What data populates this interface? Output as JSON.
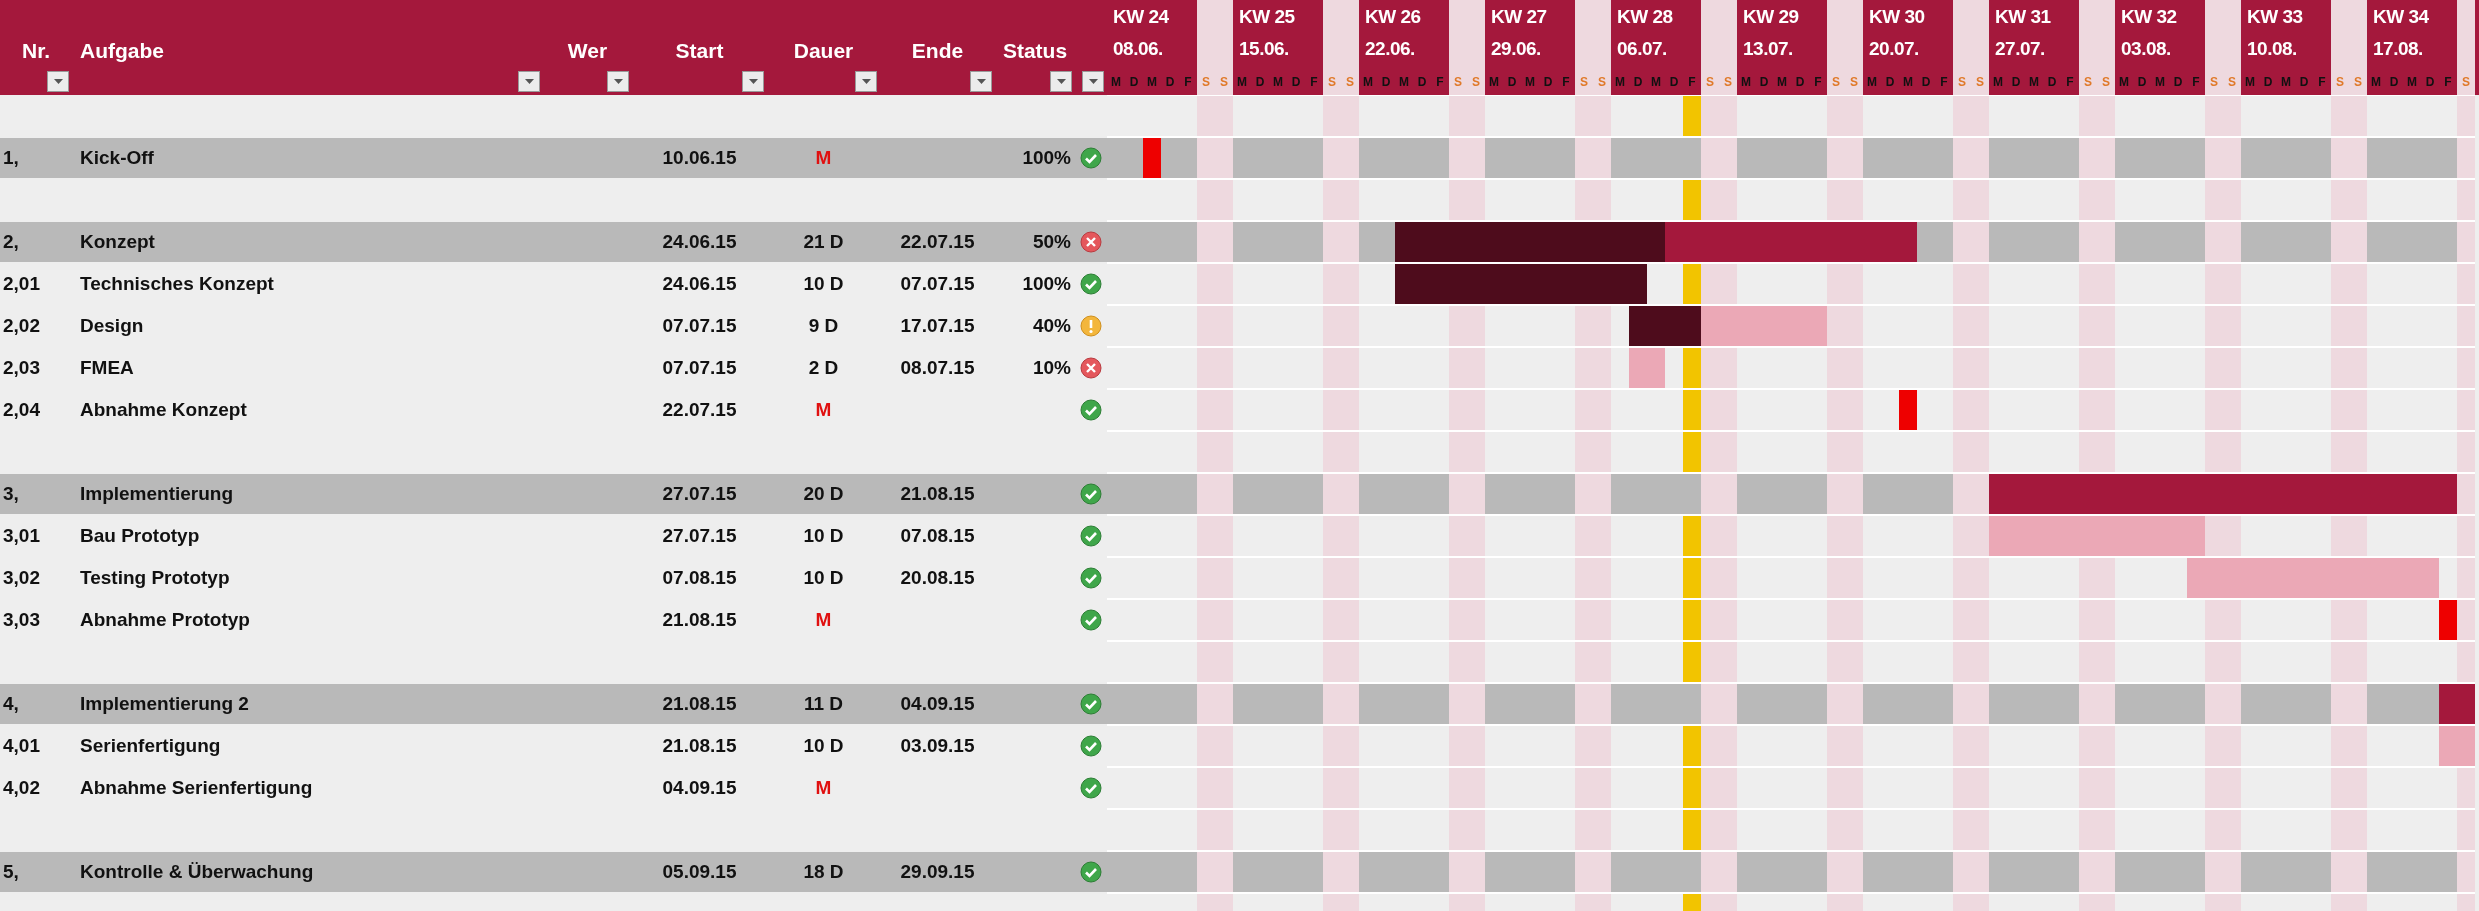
{
  "columns": [
    {
      "label": "Nr.",
      "filter": true
    },
    {
      "label": "Aufgabe",
      "filter": true
    },
    {
      "label": "Wer",
      "filter": true
    },
    {
      "label": "Start",
      "filter": true
    },
    {
      "label": "Dauer",
      "filter": true
    },
    {
      "label": "Ende",
      "filter": true
    },
    {
      "label": "Status",
      "filter": true
    },
    {
      "filter": true
    }
  ],
  "weeks": [
    {
      "kw": "KW 24",
      "date": "08.06.",
      "days": [
        {
          "label": "M",
          "weekend": false,
          "today": false
        },
        {
          "label": "D",
          "weekend": false,
          "today": false
        },
        {
          "label": "M",
          "weekend": false,
          "today": false
        },
        {
          "label": "D",
          "weekend": false,
          "today": false
        },
        {
          "label": "F",
          "weekend": false,
          "today": false
        },
        {
          "label": "S",
          "weekend": true,
          "today": false
        },
        {
          "label": "S",
          "weekend": true,
          "today": false
        }
      ]
    },
    {
      "kw": "KW 25",
      "date": "15.06.",
      "days": [
        {
          "label": "M",
          "weekend": false,
          "today": false
        },
        {
          "label": "D",
          "weekend": false,
          "today": false
        },
        {
          "label": "M",
          "weekend": false,
          "today": false
        },
        {
          "label": "D",
          "weekend": false,
          "today": false
        },
        {
          "label": "F",
          "weekend": false,
          "today": false
        },
        {
          "label": "S",
          "weekend": true,
          "today": false
        },
        {
          "label": "S",
          "weekend": true,
          "today": false
        }
      ]
    },
    {
      "kw": "KW 26",
      "date": "22.06.",
      "days": [
        {
          "label": "M",
          "weekend": false,
          "today": false
        },
        {
          "label": "D",
          "weekend": false,
          "today": false
        },
        {
          "label": "M",
          "weekend": false,
          "today": false
        },
        {
          "label": "D",
          "weekend": false,
          "today": false
        },
        {
          "label": "F",
          "weekend": false,
          "today": false
        },
        {
          "label": "S",
          "weekend": true,
          "today": false
        },
        {
          "label": "S",
          "weekend": true,
          "today": false
        }
      ]
    },
    {
      "kw": "KW 27",
      "date": "29.06.",
      "days": [
        {
          "label": "M",
          "weekend": false,
          "today": false
        },
        {
          "label": "D",
          "weekend": false,
          "today": false
        },
        {
          "label": "M",
          "weekend": false,
          "today": false
        },
        {
          "label": "D",
          "weekend": false,
          "today": false
        },
        {
          "label": "F",
          "weekend": false,
          "today": false
        },
        {
          "label": "S",
          "weekend": true,
          "today": false
        },
        {
          "label": "S",
          "weekend": true,
          "today": false
        }
      ]
    },
    {
      "kw": "KW 28",
      "date": "06.07.",
      "days": [
        {
          "label": "M",
          "weekend": false,
          "today": false
        },
        {
          "label": "D",
          "weekend": false,
          "today": false
        },
        {
          "label": "M",
          "weekend": false,
          "today": false
        },
        {
          "label": "D",
          "weekend": false,
          "today": false
        },
        {
          "label": "F",
          "weekend": false,
          "today": true
        },
        {
          "label": "S",
          "weekend": true,
          "today": false
        },
        {
          "label": "S",
          "weekend": true,
          "today": false
        }
      ]
    },
    {
      "kw": "KW 29",
      "date": "13.07.",
      "days": [
        {
          "label": "M",
          "weekend": false,
          "today": false
        },
        {
          "label": "D",
          "weekend": false,
          "today": false
        },
        {
          "label": "M",
          "weekend": false,
          "today": false
        },
        {
          "label": "D",
          "weekend": false,
          "today": false
        },
        {
          "label": "F",
          "weekend": false,
          "today": false
        },
        {
          "label": "S",
          "weekend": true,
          "today": false
        },
        {
          "label": "S",
          "weekend": true,
          "today": false
        }
      ]
    },
    {
      "kw": "KW 30",
      "date": "20.07.",
      "days": [
        {
          "label": "M",
          "weekend": false,
          "today": false
        },
        {
          "label": "D",
          "weekend": false,
          "today": false
        },
        {
          "label": "M",
          "weekend": false,
          "today": false
        },
        {
          "label": "D",
          "weekend": false,
          "today": false
        },
        {
          "label": "F",
          "weekend": false,
          "today": false
        },
        {
          "label": "S",
          "weekend": true,
          "today": false
        },
        {
          "label": "S",
          "weekend": true,
          "today": false
        }
      ]
    },
    {
      "kw": "KW 31",
      "date": "27.07.",
      "days": [
        {
          "label": "M",
          "weekend": false,
          "today": false
        },
        {
          "label": "D",
          "weekend": false,
          "today": false
        },
        {
          "label": "M",
          "weekend": false,
          "today": false
        },
        {
          "label": "D",
          "weekend": false,
          "today": false
        },
        {
          "label": "F",
          "weekend": false,
          "today": false
        },
        {
          "label": "S",
          "weekend": true,
          "today": false
        },
        {
          "label": "S",
          "weekend": true,
          "today": false
        }
      ]
    },
    {
      "kw": "KW 32",
      "date": "03.08.",
      "days": [
        {
          "label": "M",
          "weekend": false,
          "today": false
        },
        {
          "label": "D",
          "weekend": false,
          "today": false
        },
        {
          "label": "M",
          "weekend": false,
          "today": false
        },
        {
          "label": "D",
          "weekend": false,
          "today": false
        },
        {
          "label": "F",
          "weekend": false,
          "today": false
        },
        {
          "label": "S",
          "weekend": true,
          "today": false
        },
        {
          "label": "S",
          "weekend": true,
          "today": false
        }
      ]
    },
    {
      "kw": "KW 33",
      "date": "10.08.",
      "days": [
        {
          "label": "M",
          "weekend": false,
          "today": false
        },
        {
          "label": "D",
          "weekend": false,
          "today": false
        },
        {
          "label": "M",
          "weekend": false,
          "today": false
        },
        {
          "label": "D",
          "weekend": false,
          "today": false
        },
        {
          "label": "F",
          "weekend": false,
          "today": false
        },
        {
          "label": "S",
          "weekend": true,
          "today": false
        },
        {
          "label": "S",
          "weekend": true,
          "today": false
        }
      ]
    },
    {
      "kw": "KW 34",
      "date": "17.08.",
      "days": [
        {
          "label": "M",
          "weekend": false,
          "today": false
        },
        {
          "label": "D",
          "weekend": false,
          "today": false
        },
        {
          "label": "M",
          "weekend": false,
          "today": false
        },
        {
          "label": "D",
          "weekend": false,
          "today": false
        },
        {
          "label": "F",
          "weekend": false,
          "today": false
        },
        {
          "label": "S",
          "weekend": true,
          "today": false
        }
      ]
    }
  ],
  "rows": [
    {
      "kind": "blank"
    },
    {
      "kind": "group",
      "nr": "1,",
      "name": "Kick-Off",
      "start": "10.06.15",
      "duration": "M",
      "milestone": true,
      "percent": "100%",
      "status_icon": {
        "kind": "ok"
      }
    },
    {
      "kind": "blank"
    },
    {
      "kind": "group",
      "nr": "2,",
      "name": "Konzept",
      "start": "24.06.15",
      "duration": "21 D",
      "end": "22.07.15",
      "milestone": false,
      "percent": "50%",
      "status_icon": {
        "kind": "error"
      }
    },
    {
      "kind": "task",
      "nr": "2,01",
      "name": "Technisches Konzept",
      "start": "24.06.15",
      "duration": "10 D",
      "end": "07.07.15",
      "milestone": false,
      "percent": "100%",
      "status_icon": {
        "kind": "ok"
      }
    },
    {
      "kind": "task",
      "nr": "2,02",
      "name": "Design",
      "start": "07.07.15",
      "duration": "9 D",
      "end": "17.07.15",
      "milestone": false,
      "percent": "40%",
      "status_icon": {
        "kind": "warn"
      }
    },
    {
      "kind": "task",
      "nr": "2,03",
      "name": "FMEA",
      "start": "07.07.15",
      "duration": "2 D",
      "end": "08.07.15",
      "milestone": false,
      "percent": "10%",
      "status_icon": {
        "kind": "error"
      }
    },
    {
      "kind": "task",
      "nr": "2,04",
      "name": "Abnahme Konzept",
      "start": "22.07.15",
      "duration": "M",
      "milestone": true,
      "status_icon": {
        "kind": "ok"
      }
    },
    {
      "kind": "blank"
    },
    {
      "kind": "group",
      "nr": "3,",
      "name": "Implementierung",
      "start": "27.07.15",
      "duration": "20 D",
      "end": "21.08.15",
      "milestone": false,
      "status_icon": {
        "kind": "ok"
      }
    },
    {
      "kind": "task",
      "nr": "3,01",
      "name": "Bau Prototyp",
      "start": "27.07.15",
      "duration": "10 D",
      "end": "07.08.15",
      "milestone": false,
      "status_icon": {
        "kind": "ok"
      }
    },
    {
      "kind": "task",
      "nr": "3,02",
      "name": "Testing Prototyp",
      "start": "07.08.15",
      "duration": "10 D",
      "end": "20.08.15",
      "milestone": false,
      "status_icon": {
        "kind": "ok"
      }
    },
    {
      "kind": "task",
      "nr": "3,03",
      "name": "Abnahme Prototyp",
      "start": "21.08.15",
      "duration": "M",
      "milestone": true,
      "status_icon": {
        "kind": "ok"
      }
    },
    {
      "kind": "blank"
    },
    {
      "kind": "group",
      "nr": "4,",
      "name": "Implementierung 2",
      "start": "21.08.15",
      "duration": "11 D",
      "end": "04.09.15",
      "milestone": false,
      "status_icon": {
        "kind": "ok"
      }
    },
    {
      "kind": "task",
      "nr": "4,01",
      "name": "Serienfertigung",
      "start": "21.08.15",
      "duration": "10 D",
      "end": "03.09.15",
      "milestone": false,
      "status_icon": {
        "kind": "ok"
      }
    },
    {
      "kind": "task",
      "nr": "4,02",
      "name": "Abnahme Serienfertigung",
      "start": "04.09.15",
      "duration": "M",
      "milestone": true,
      "status_icon": {
        "kind": "ok"
      }
    },
    {
      "kind": "blank"
    },
    {
      "kind": "group",
      "nr": "5,",
      "name": "Kontrolle & Überwachung",
      "start": "05.09.15",
      "duration": "18 D",
      "end": "29.09.15",
      "milestone": false,
      "status_icon": {
        "kind": "ok"
      }
    },
    {
      "kind": "blank"
    }
  ]
}
